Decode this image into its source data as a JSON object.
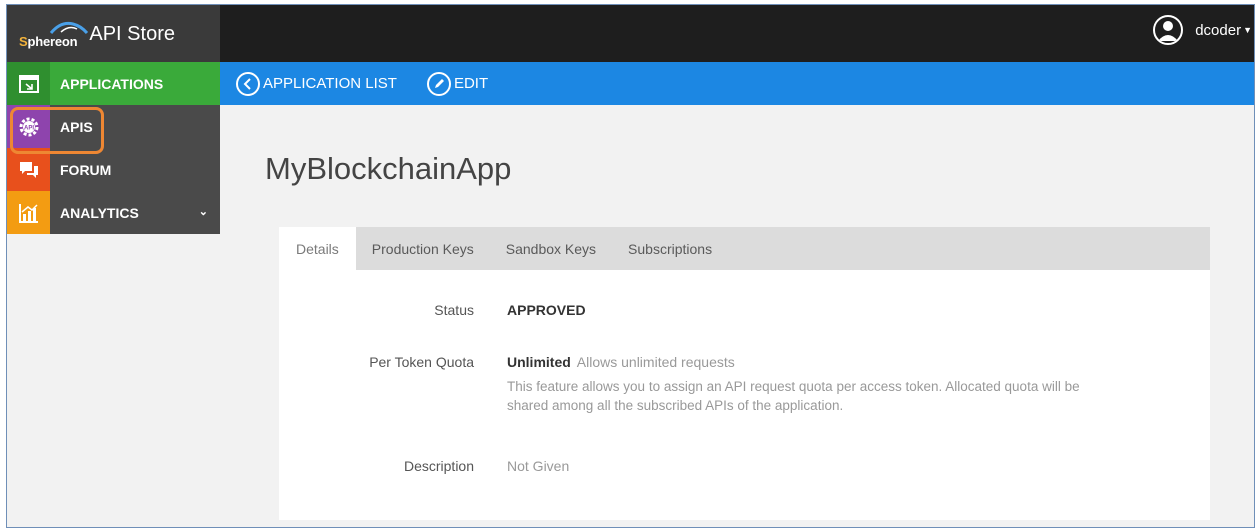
{
  "header": {
    "logo_prefix": "S",
    "logo_text": "phereon",
    "title": "API Store",
    "username": "dcoder",
    "icons": [
      "user-avatar-icon",
      "caret-down-icon"
    ]
  },
  "sidebar": {
    "items": [
      {
        "label": "APPLICATIONS",
        "icon": "application-window-icon",
        "color": "#3aaa3a"
      },
      {
        "label": "APIS",
        "icon": "api-gear-icon",
        "color": "#8e44ad"
      },
      {
        "label": "FORUM",
        "icon": "chat-bubbles-icon",
        "color": "#e8501c"
      },
      {
        "label": "ANALYTICS",
        "icon": "bar-chart-icon",
        "color": "#f39c12"
      }
    ]
  },
  "navbar": {
    "back_label": "APPLICATION LIST",
    "edit_label": "EDIT",
    "color": "#1c87e3"
  },
  "main": {
    "app_name": "MyBlockchainApp",
    "tabs": [
      {
        "label": "Details",
        "active": true
      },
      {
        "label": "Production Keys",
        "active": false
      },
      {
        "label": "Sandbox Keys",
        "active": false
      },
      {
        "label": "Subscriptions",
        "active": false
      }
    ],
    "details": {
      "status_label": "Status",
      "status_value": "APPROVED",
      "quota_label": "Per Token Quota",
      "quota_value": "Unlimited",
      "quota_desc": "Allows unlimited requests",
      "quota_note": "This feature allows you to assign an API request quota per access token. Allocated quota will be shared among all the subscribed APIs of the application.",
      "description_label": "Description",
      "description_value": "Not Given"
    }
  },
  "accent": {
    "highlight_outline": "#ee8733"
  }
}
